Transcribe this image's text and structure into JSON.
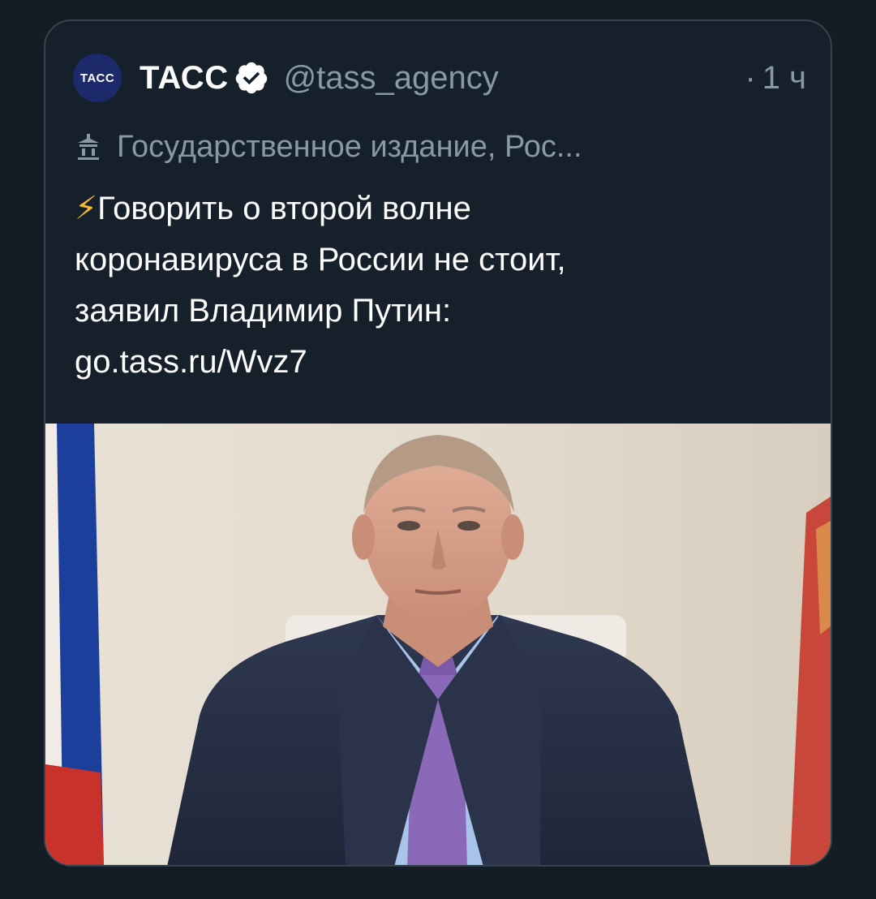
{
  "tweet": {
    "avatar_text": "ТАСС",
    "account_name": "ТАСС",
    "handle": "@tass_agency",
    "time_separator": "·",
    "time": "1 ч",
    "label": "Государственное издание, Рос...",
    "bolt": "⚡",
    "text_lines": [
      "Говорить о второй волне",
      "коронавируса в России не стоит,",
      "заявил Владимир Путин:"
    ],
    "link": "go.tass.ru/Wvz7"
  },
  "icons": {
    "verified": "verified-badge-icon",
    "government": "government-building-icon"
  },
  "colors": {
    "background": "#141d26",
    "card": "#15202b",
    "border": "#38444d",
    "secondary_text": "#8899a6",
    "primary_text": "#ffffff",
    "avatar_bg": "#1d2a6b",
    "bolt": "#f5b82e"
  }
}
